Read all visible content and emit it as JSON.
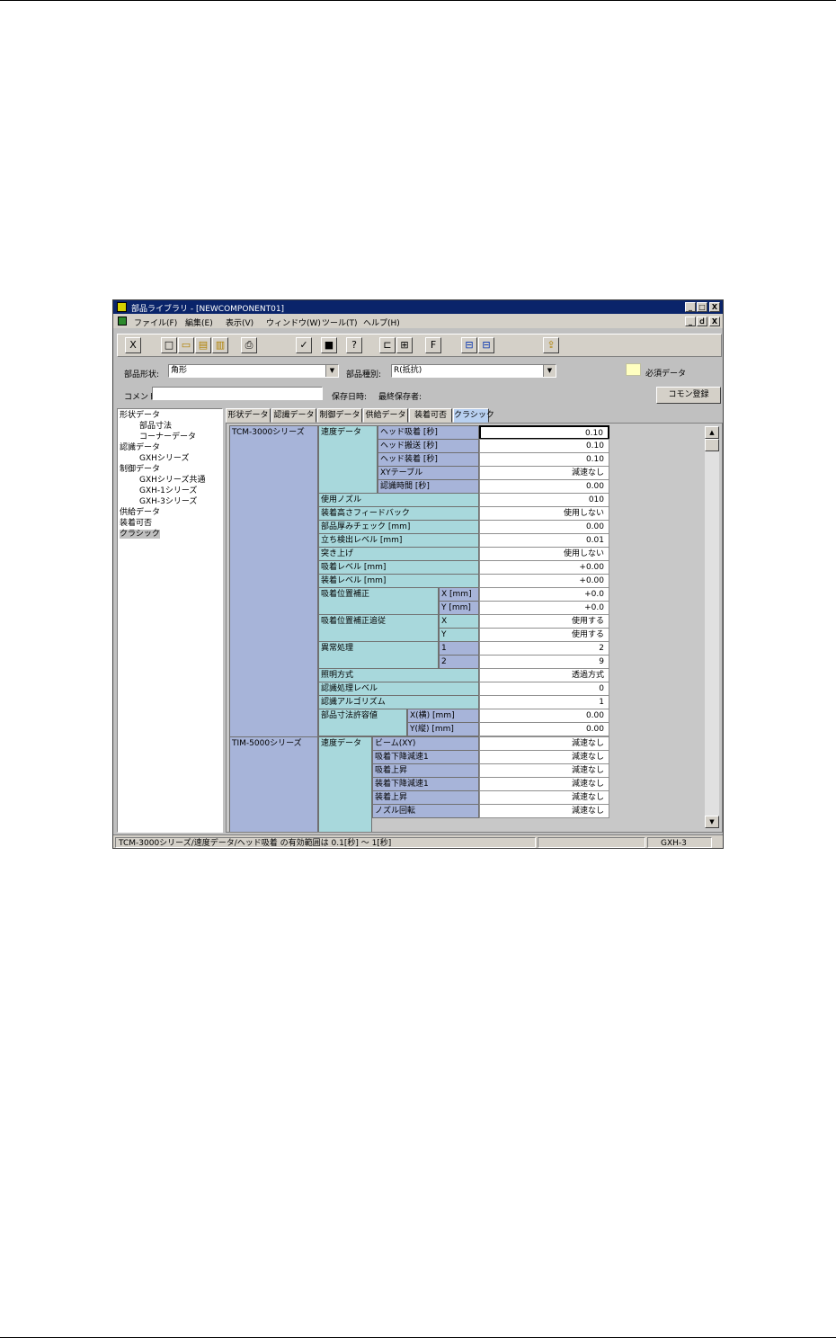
{
  "window": {
    "title": "部品ライブラリ - [NEWCOMPONENT01]",
    "minimize": "_",
    "maximize": "□",
    "close": "X",
    "restore": "ｄ"
  },
  "menu": [
    "ファイル(F)",
    "編集(E)",
    "表示(V)",
    "ウィンドウ(W)",
    "ツール(T)",
    "ヘルプ(H)"
  ],
  "toolbar_icons": {
    "close": "X",
    "new": "□",
    "open": "▭",
    "save": "▤",
    "saveas": "▥",
    "print": "⎙",
    "check": "✓",
    "stop": "■",
    "help": "?",
    "view1": "⊏",
    "view2": "⊞",
    "font": "F",
    "win1": "⊟",
    "win2": "⊟",
    "upload": "⇪"
  },
  "form": {
    "shape_label": "部品形状:",
    "shape_value": "角形",
    "type_label": "部品種別:",
    "type_value": "R(抵抗)",
    "required_label": "必須データ",
    "comment_label": "コメント",
    "saved_label": "保存日時:",
    "saver_label": "最終保存者:",
    "common_register": "コモン登録"
  },
  "tree": [
    {
      "label": "形状データ"
    },
    {
      "label": "部品寸法"
    },
    {
      "label": "コーナーデータ"
    },
    {
      "label": "認識データ"
    },
    {
      "label": "GXHシリーズ"
    },
    {
      "label": "制御データ"
    },
    {
      "label": "GXHシリーズ共通"
    },
    {
      "label": "GXH-1シリーズ"
    },
    {
      "label": "GXH-3シリーズ"
    },
    {
      "label": "供給データ"
    },
    {
      "label": "装着可否"
    },
    {
      "label": "クラシック"
    }
  ],
  "tabs": [
    "形状データ",
    "認識データ",
    "制御データ",
    "供給データ",
    "装着可否",
    "クラシック"
  ],
  "grid": {
    "group1": "TCM-3000シリーズ",
    "group2": "TIM-5000シリーズ",
    "speed_data": "速度データ",
    "rows": [
      {
        "label": "ヘッド吸着 [秒]",
        "value": "0.10"
      },
      {
        "label": "ヘッド搬送 [秒]",
        "value": "0.10"
      },
      {
        "label": "ヘッド装着 [秒]",
        "value": "0.10"
      },
      {
        "label": "XYテーブル",
        "value": "減速なし"
      },
      {
        "label": "認識時間 [秒]",
        "value": "0.00"
      },
      {
        "label": "使用ノズル",
        "value": "010"
      },
      {
        "label": "装着高さフィードバック",
        "value": "使用しない"
      },
      {
        "label": "部品厚みチェック [mm]",
        "value": "0.00"
      },
      {
        "label": "立ち検出レベル [mm]",
        "value": "0.01"
      },
      {
        "label": "突き上げ",
        "value": "使用しない"
      },
      {
        "label": "吸着レベル [mm]",
        "value": "+0.00"
      },
      {
        "label": "装着レベル [mm]",
        "value": "+0.00"
      },
      {
        "label": "X [mm]",
        "value": "+0.0"
      },
      {
        "label": "Y [mm]",
        "value": "+0.0"
      },
      {
        "label": "X",
        "value": "使用する"
      },
      {
        "label": "Y",
        "value": "使用する"
      },
      {
        "label": "1",
        "value": "2"
      },
      {
        "label": "2",
        "value": "9"
      },
      {
        "label": "照明方式",
        "value": "透過方式"
      },
      {
        "label": "認識処理レベル",
        "value": "0"
      },
      {
        "label": "認識アルゴリズム",
        "value": "1"
      },
      {
        "label": "X(横) [mm]",
        "value": "0.00"
      },
      {
        "label": "Y(縦) [mm]",
        "value": "0.00"
      }
    ],
    "pickup_correction": "吸着位置補正",
    "pickup_follow": "吸着位置補正追従",
    "error_process": "異常処理",
    "dimension_tolerance": "部品寸法許容値",
    "rows2": [
      {
        "label": "ビーム(XY)",
        "value": "減速なし"
      },
      {
        "label": "吸着下降減速1",
        "value": "減速なし"
      },
      {
        "label": "吸着上昇",
        "value": "減速なし"
      },
      {
        "label": "装着下降減速1",
        "value": "減速なし"
      },
      {
        "label": "装着上昇",
        "value": "減速なし"
      },
      {
        "label": "ノズル回転",
        "value": "減速なし"
      }
    ]
  },
  "status": {
    "message": "TCM-3000シリーズ/速度データ/ヘッド吸着 の有効範囲は 0.1[秒] ～ 1[秒]",
    "machine": "GXH-3"
  }
}
